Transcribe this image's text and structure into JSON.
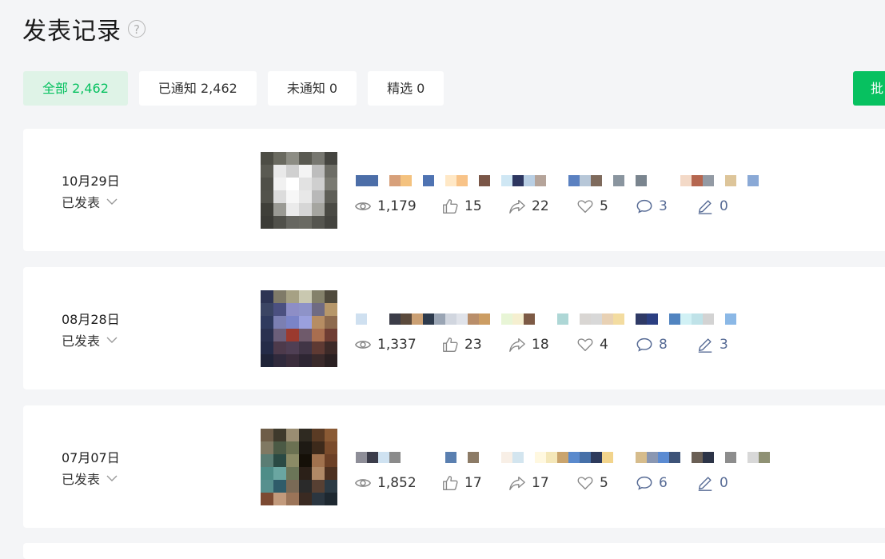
{
  "page": {
    "title": "发表记录",
    "help_icon": "?"
  },
  "tabs": [
    {
      "label": "全部 2,462",
      "active": true
    },
    {
      "label": "已通知 2,462",
      "active": false
    },
    {
      "label": "未通知 0",
      "active": false
    },
    {
      "label": "精选 0",
      "active": false
    }
  ],
  "batch_button": {
    "label": "批",
    "color": "#07c160"
  },
  "colors": {
    "accent": "#07c160",
    "link_blue": "#576b95",
    "background": "#f4f5f7"
  },
  "posts": [
    {
      "date": "10月29日",
      "status": "已发表",
      "stats": {
        "views": "1,179",
        "likes": "15",
        "shares": "22",
        "favorites": "5",
        "comments": "3",
        "edits": "0"
      }
    },
    {
      "date": "08月28日",
      "status": "已发表",
      "stats": {
        "views": "1,337",
        "likes": "23",
        "shares": "18",
        "favorites": "4",
        "comments": "8",
        "edits": "3"
      }
    },
    {
      "date": "07月07日",
      "status": "已发表",
      "stats": {
        "views": "1,852",
        "likes": "17",
        "shares": "17",
        "favorites": "5",
        "comments": "6",
        "edits": "0"
      }
    }
  ],
  "icons": [
    "eye-icon",
    "thumbs-up-icon",
    "share-icon",
    "heart-icon",
    "comment-icon",
    "pen-icon",
    "chevron-down-icon",
    "help-icon"
  ]
}
